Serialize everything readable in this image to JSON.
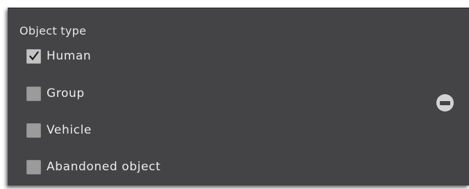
{
  "object_type": {
    "title": "Object type",
    "options": [
      {
        "label": "Human",
        "checked": true
      },
      {
        "label": "Group",
        "checked": false
      },
      {
        "label": "Vehicle",
        "checked": false
      },
      {
        "label": "Abandoned object",
        "checked": false
      }
    ]
  },
  "remove_button": {
    "icon": "minus-circle-icon"
  },
  "colors": {
    "panel_background": "#444447",
    "text": "#ececec",
    "checkbox": "#9b9b9b",
    "checkbox_checked": "#c3c3c3",
    "remove_button": "#d3d3d3"
  }
}
